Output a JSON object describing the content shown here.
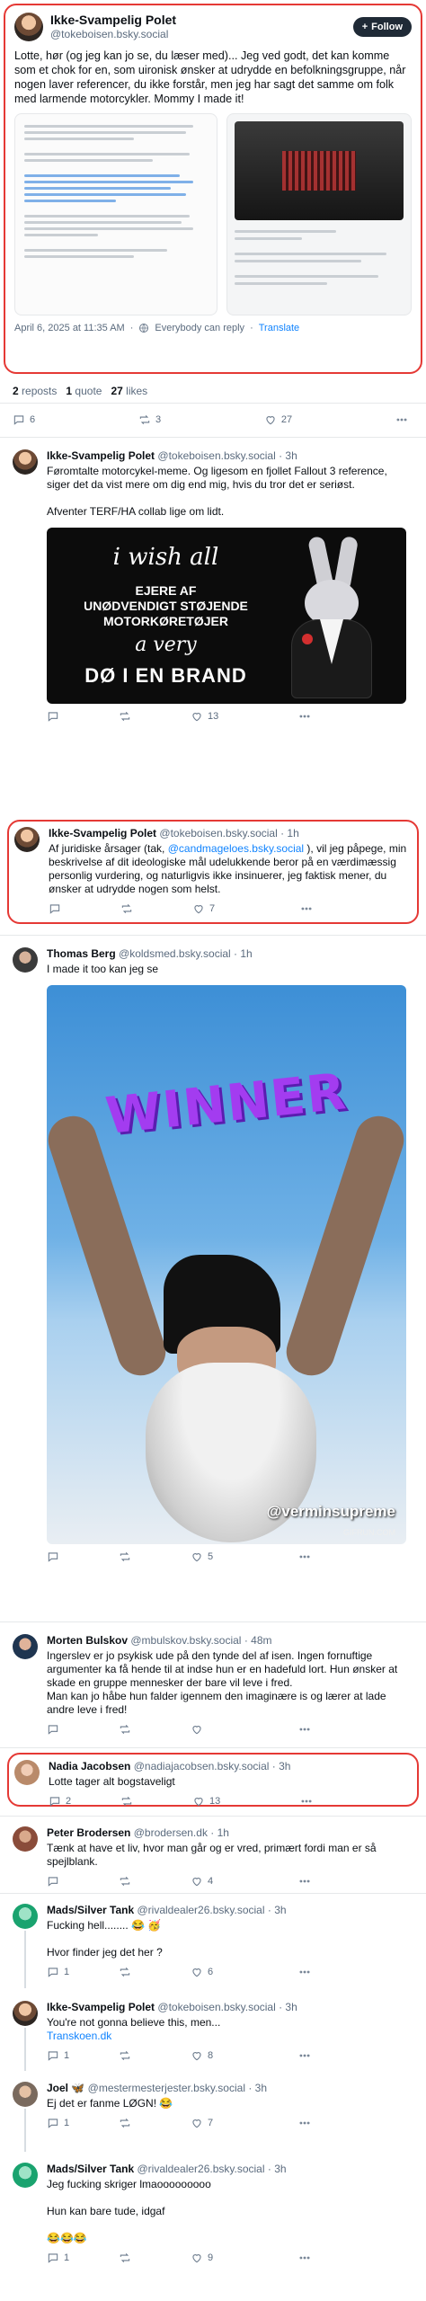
{
  "main_post": {
    "author_name": "Ikke-Svampelig Polet",
    "author_handle": "@tokeboisen.bsky.social",
    "follow_label": "Follow",
    "text": "Lotte, hør (og jeg kan jo se, du læser med)... Jeg ved godt, det kan komme som et chok for en, som uironisk ønsker at udrydde en befolkningsgruppe, når nogen laver referencer, du ikke forstår, men jeg har sagt det samme om folk med larmende motorcykler. Mommy I made it!",
    "date": "April 6, 2025 at 11:35 AM",
    "audience": "Everybody can reply",
    "translate": "Translate"
  },
  "counts": {
    "reposts_num": "2",
    "reposts_label": "reposts",
    "quotes_num": "1",
    "quotes_label": "quote",
    "likes_num": "27",
    "likes_label": "likes"
  },
  "main_actions": {
    "replies": "6",
    "reposts": "3",
    "likes": "27"
  },
  "replies": [
    {
      "name": "Ikke-Svampelig Polet",
      "handle": "@tokeboisen.bsky.social",
      "time": "· 3h",
      "text": "Føromtalte motorcykel-meme. Og ligesom en fjollet Fallout 3 reference, siger det da vist mere om dig end mig, hvis du tror det er seriøst.\n\nAfventer TERF/HA collab lige om lidt.",
      "replies": "",
      "reposts": "",
      "likes": "13",
      "meme": {
        "line1": "i wish all",
        "line2": "EJERE AF\nUNØDVENDIGT STØJENDE\nMOTORKØRETØJER",
        "line3": "a very",
        "line4": "DØ I EN BRAND"
      }
    },
    {
      "name": "Ikke-Svampelig Polet",
      "handle": "@tokeboisen.bsky.social",
      "time": "· 1h",
      "text_before": "Af juridiske årsager (tak, ",
      "mention": "@candmageloes.bsky.social",
      "text_after": " ), vil jeg påpege, min beskrivelse af dit ideologiske mål udelukkende beror på en værdimæssig personlig vurdering, og naturligvis ikke insinuerer, jeg faktisk mener, du ønsker at udrydde nogen som helst.",
      "replies": "",
      "reposts": "",
      "likes": "7"
    },
    {
      "name": "Thomas Berg",
      "handle": "@koldsmed.bsky.social",
      "time": "· 1h",
      "text": "I made it too kan jeg se",
      "replies": "",
      "reposts": "",
      "likes": "5",
      "gif": {
        "title": "WINNER",
        "watermark": "@verminsupreme",
        "source": "GIFRUN.COM"
      }
    },
    {
      "name": "Morten Bulskov",
      "handle": "@mbulskov.bsky.social",
      "time": "· 48m",
      "text": "Ingerslev er jo psykisk ude på den tynde del af isen. Ingen fornuftige argumenter ka få hende til at indse hun er en hadefuld lort. Hun ønsker at skade en gruppe mennesker der bare vil leve i fred.\nMan kan jo håbe hun falder igennem den imaginære is og lærer at lade andre leve i fred!",
      "replies": "",
      "reposts": "",
      "likes": ""
    },
    {
      "name": "Nadia Jacobsen",
      "handle": "@nadiajacobsen.bsky.social",
      "time": "· 3h",
      "text": "Lotte tager alt bogstaveligt",
      "replies": "2",
      "reposts": "",
      "likes": "13"
    },
    {
      "name": "Peter Brodersen",
      "handle": "@brodersen.dk",
      "time": "· 1h",
      "text": "Tænk at have et liv, hvor man går og er vred, primært fordi man er så spejlblank.",
      "replies": "",
      "reposts": "",
      "likes": "4"
    },
    {
      "name": "Mads/Silver Tank",
      "handle": "@rivaldealer26.bsky.social",
      "time": "· 3h",
      "text": "Fucking hell........ 😂 🥳\n\nHvor finder jeg det her ?",
      "replies": "1",
      "reposts": "",
      "likes": "6"
    },
    {
      "name": "Ikke-Svampelig Polet",
      "handle": "@tokeboisen.bsky.social",
      "time": "· 3h",
      "text": "You're not gonna believe this, men...",
      "link": "Transkoen.dk",
      "replies": "1",
      "reposts": "",
      "likes": "8"
    },
    {
      "name": "Joel 🦋",
      "handle": "@mestermesterjester.bsky.social",
      "time": "· 3h",
      "text": "Ej det er fanme LØGN! 😂",
      "replies": "1",
      "reposts": "",
      "likes": "7"
    },
    {
      "name": "Mads/Silver Tank",
      "handle": "@rivaldealer26.bsky.social",
      "time": "· 3h",
      "text": "Jeg fucking skriger lmaooooooooo\n\nHun kan bare tude, idgaf\n\n😂😂😂",
      "replies": "1",
      "reposts": "",
      "likes": "9"
    }
  ]
}
